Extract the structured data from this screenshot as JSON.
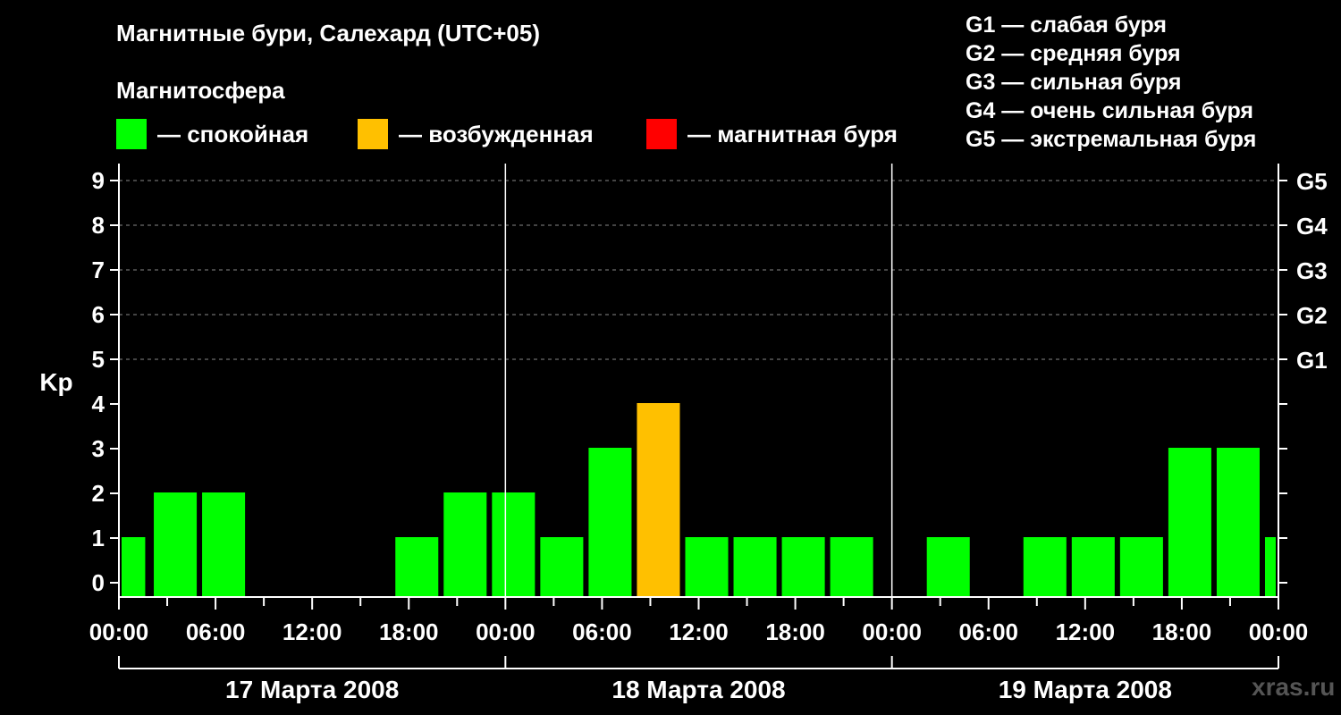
{
  "title": "Магнитные бури, Салехард (UTC+05)",
  "magnetosphere_label": "Магнитосфера",
  "legend": [
    {
      "color": "#00ff00",
      "label": "— спокойная"
    },
    {
      "color": "#ffc000",
      "label": "— возбужденная"
    },
    {
      "color": "#ff0000",
      "label": "— магнитная буря"
    }
  ],
  "storm_scale": [
    "G1 — слабая буря",
    "G2 — средняя буря",
    "G3 — сильная буря",
    "G4 — очень сильная буря",
    "G5 — экстремальная буря"
  ],
  "watermark": "xras.ru",
  "chart_data": {
    "type": "bar",
    "ylabel": "Kp",
    "ylim": [
      0,
      9
    ],
    "y_ticks": [
      "0",
      "1",
      "2",
      "3",
      "4",
      "5",
      "6",
      "7",
      "8",
      "9"
    ],
    "right_axis_labels": [
      {
        "kp": 5,
        "label": "G1"
      },
      {
        "kp": 6,
        "label": "G2"
      },
      {
        "kp": 7,
        "label": "G3"
      },
      {
        "kp": 8,
        "label": "G4"
      },
      {
        "kp": 9,
        "label": "G5"
      }
    ],
    "x_tick_labels": [
      "00:00",
      "06:00",
      "12:00",
      "18:00",
      "00:00",
      "06:00",
      "12:00",
      "18:00",
      "00:00",
      "06:00",
      "12:00",
      "18:00",
      "00:00"
    ],
    "days": [
      "17 Марта 2008",
      "18 Марта 2008",
      "19 Марта 2008"
    ],
    "grid": "dashed at Kp 5-9",
    "bars": [
      {
        "start_hour": 0,
        "end_hour": 1.8,
        "kp": 1,
        "level": "calm"
      },
      {
        "start_hour": 2,
        "end_hour": 5,
        "kp": 2,
        "level": "calm"
      },
      {
        "start_hour": 5,
        "end_hour": 8,
        "kp": 2,
        "level": "calm"
      },
      {
        "start_hour": 17,
        "end_hour": 20,
        "kp": 1,
        "level": "calm"
      },
      {
        "start_hour": 20,
        "end_hour": 23,
        "kp": 2,
        "level": "calm"
      },
      {
        "start_hour": 23,
        "end_hour": 26,
        "kp": 2,
        "level": "calm"
      },
      {
        "start_hour": 26,
        "end_hour": 29,
        "kp": 1,
        "level": "calm"
      },
      {
        "start_hour": 29,
        "end_hour": 32,
        "kp": 3,
        "level": "calm"
      },
      {
        "start_hour": 32,
        "end_hour": 35,
        "kp": 4,
        "level": "active"
      },
      {
        "start_hour": 35,
        "end_hour": 38,
        "kp": 1,
        "level": "calm"
      },
      {
        "start_hour": 38,
        "end_hour": 41,
        "kp": 1,
        "level": "calm"
      },
      {
        "start_hour": 41,
        "end_hour": 44,
        "kp": 1,
        "level": "calm"
      },
      {
        "start_hour": 44,
        "end_hour": 47,
        "kp": 1,
        "level": "calm"
      },
      {
        "start_hour": 50,
        "end_hour": 53,
        "kp": 1,
        "level": "calm"
      },
      {
        "start_hour": 56,
        "end_hour": 59,
        "kp": 1,
        "level": "calm"
      },
      {
        "start_hour": 59,
        "end_hour": 62,
        "kp": 1,
        "level": "calm"
      },
      {
        "start_hour": 62,
        "end_hour": 65,
        "kp": 1,
        "level": "calm"
      },
      {
        "start_hour": 65,
        "end_hour": 68,
        "kp": 3,
        "level": "calm"
      },
      {
        "start_hour": 68,
        "end_hour": 71,
        "kp": 3,
        "level": "calm"
      },
      {
        "start_hour": 71,
        "end_hour": 72,
        "kp": 1,
        "level": "calm"
      }
    ],
    "level_colors": {
      "calm": "#00ff00",
      "active": "#ffc000",
      "storm": "#ff0000"
    }
  }
}
